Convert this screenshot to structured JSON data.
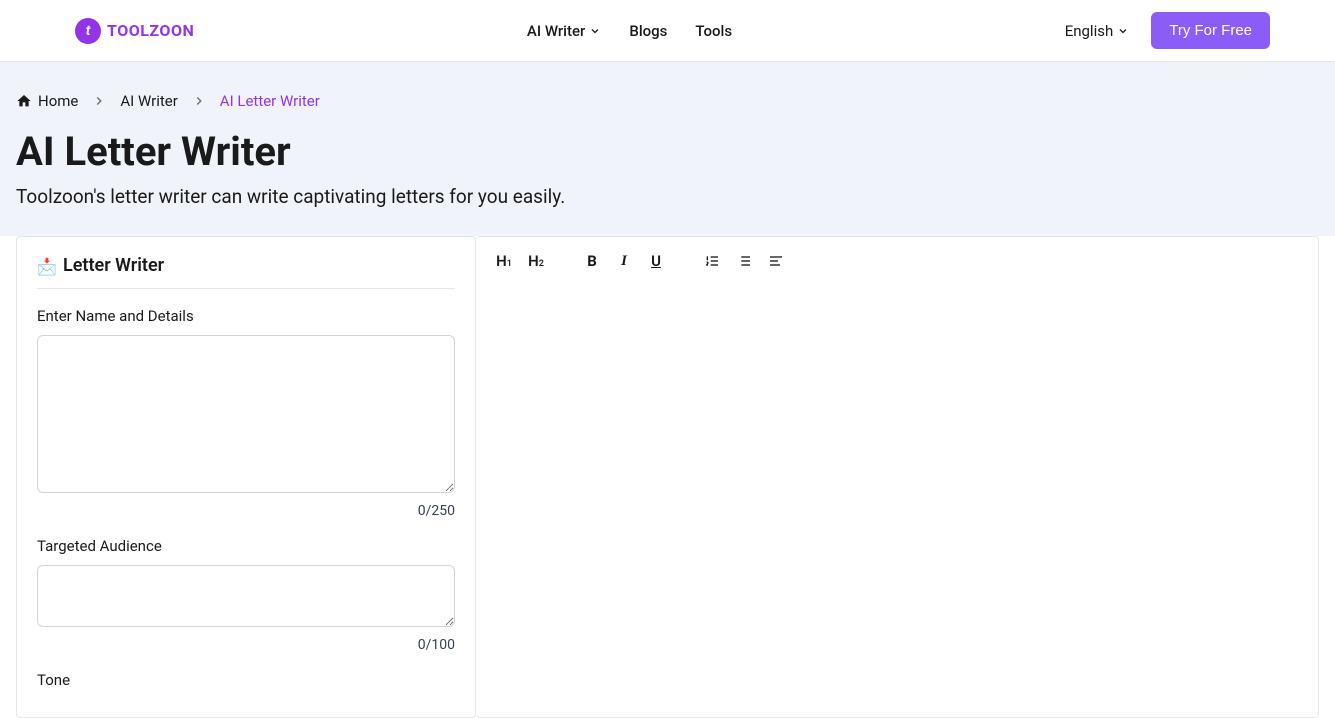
{
  "header": {
    "logo_text": "TOOLZOON",
    "nav": {
      "ai_writer": "AI Writer",
      "blogs": "Blogs",
      "tools": "Tools"
    },
    "language": "English",
    "cta": "Try For Free"
  },
  "breadcrumb": {
    "home": "Home",
    "ai_writer": "AI Writer",
    "current": "AI Letter Writer"
  },
  "page": {
    "title": "AI Letter Writer",
    "subtitle": "Toolzoon's letter writer can write captivating letters for you easily."
  },
  "form": {
    "panel_title": "Letter Writer",
    "name_details_label": "Enter Name and Details",
    "name_details_count": "0/250",
    "audience_label": "Targeted Audience",
    "audience_count": "0/100",
    "tone_label": "Tone"
  },
  "toolbar": {
    "h1": "H",
    "h1_sub": "1",
    "h2": "H",
    "h2_sub": "2",
    "bold": "B",
    "italic": "I",
    "underline": "U"
  }
}
